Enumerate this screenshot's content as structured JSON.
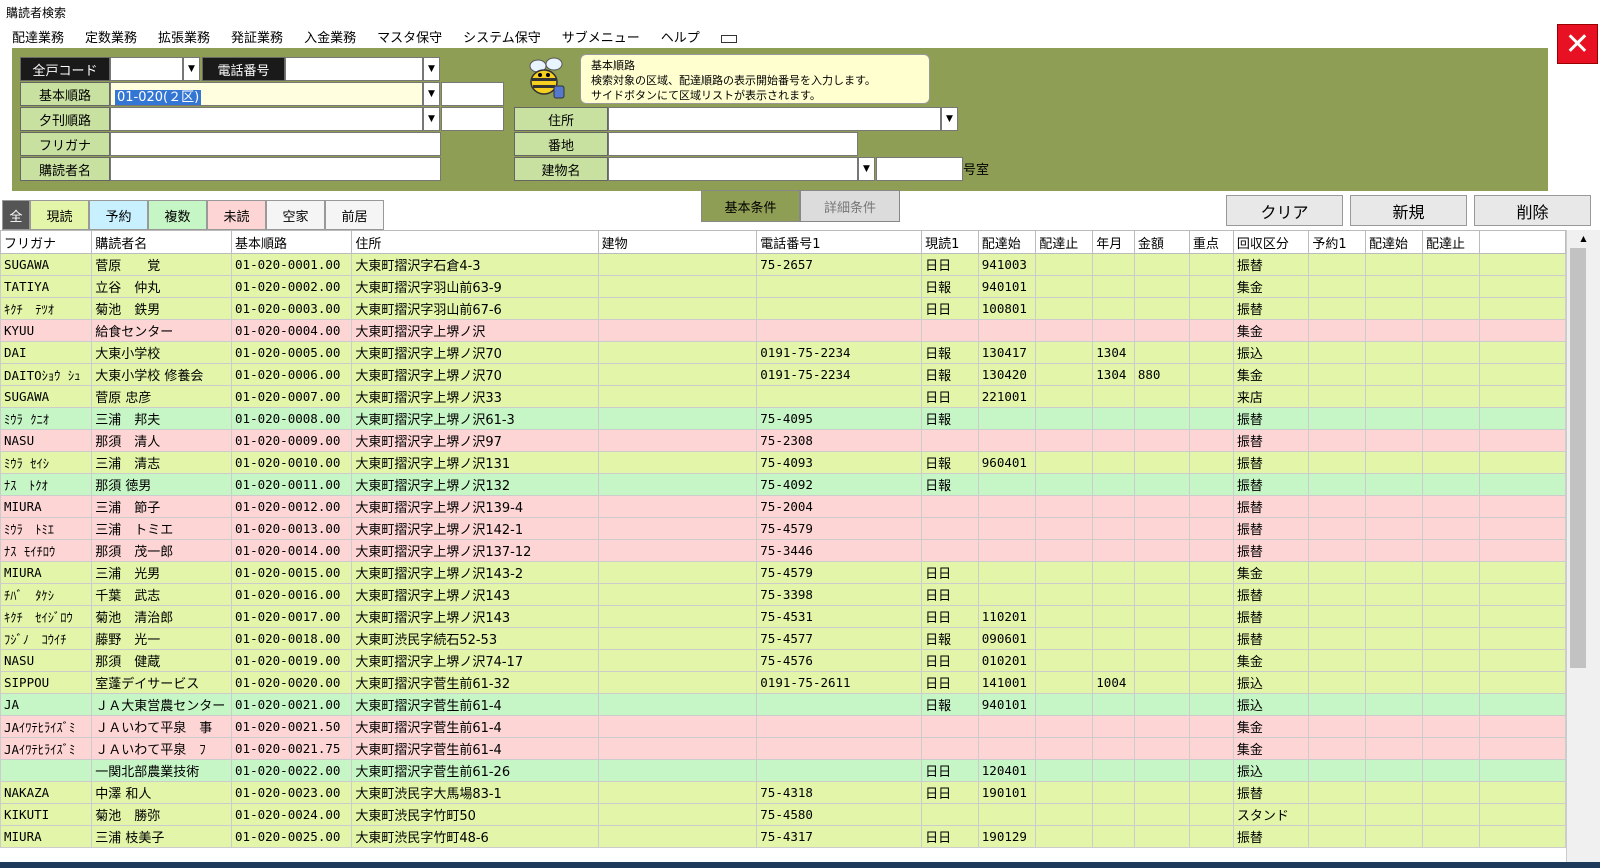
{
  "window": {
    "title": "購読者検索"
  },
  "menu": [
    "配達業務",
    "定数業務",
    "拡張業務",
    "発証業務",
    "入金業務",
    "マスタ保守",
    "システム保守",
    "サブメニュー",
    "ヘルプ"
  ],
  "search": {
    "all_code_label": "全戸コード",
    "all_code_value": "",
    "phone_label": "電話番号",
    "phone_value": "",
    "basic_route_label": "基本順路",
    "basic_route_value": "01-020(２区)",
    "evening_route_label": "夕刊順路",
    "evening_route_value": "",
    "furigana_label": "フリガナ",
    "furigana_value": "",
    "subscriber_name_label": "購読者名",
    "subscriber_name_value": "",
    "address_label": "住所",
    "address_value": "",
    "lot_label": "番地",
    "lot_value": "",
    "building_label": "建物名",
    "building_value": "",
    "room_value": "",
    "room_unit": "号室"
  },
  "tooltip": {
    "title": "基本順路",
    "line1": "検索対象の区域、配達順路の表示開始番号を入力します。",
    "line2": "サイドボタンにて区域リストが表示されます。"
  },
  "filter_tabs": [
    "全",
    "現読",
    "予約",
    "複数",
    "未読",
    "空家",
    "前居"
  ],
  "condition_tabs": {
    "basic": "基本条件",
    "detail": "詳細条件"
  },
  "actions": {
    "clear": "クリア",
    "new": "新規",
    "delete": "削除"
  },
  "colors": {
    "panel": "#8e9e55",
    "row_yellow": "#e2f5a8",
    "row_pink": "#fdd5d5",
    "row_green": "#c6f5c6",
    "close": "#e81123"
  },
  "table": {
    "columns": [
      "フリガナ",
      "購読者名",
      "基本順路",
      "住所",
      "建物",
      "電話番号1",
      "現読1",
      "配達始",
      "配達止",
      "年月",
      "金額",
      "重点",
      "回収区分",
      "予約1",
      "配達始",
      "配達止"
    ],
    "rows": [
      {
        "c": "y",
        "cells": [
          "SUGAWA",
          "菅原　　覚",
          "01-020-0001.00",
          "大東町摺沢字石倉4-3",
          "",
          "75-2657",
          "日日",
          "941003",
          "",
          "",
          "",
          "",
          "振替",
          "",
          "",
          ""
        ]
      },
      {
        "c": "y",
        "cells": [
          "TATIYA",
          "立谷　仲丸",
          "01-020-0002.00",
          "大東町摺沢字羽山前63-9",
          "",
          "",
          "日報",
          "940101",
          "",
          "",
          "",
          "",
          "集金",
          "",
          "",
          ""
        ]
      },
      {
        "c": "y",
        "cells": [
          "ｷｸﾁ　ﾃﾂｵ",
          "菊池　鉄男",
          "01-020-0003.00",
          "大東町摺沢字羽山前67-6",
          "",
          "",
          "日日",
          "100801",
          "",
          "",
          "",
          "",
          "振替",
          "",
          "",
          ""
        ]
      },
      {
        "c": "p",
        "cells": [
          "KYUU",
          "給食センター",
          "01-020-0004.00",
          "大東町摺沢字上堺ノ沢",
          "",
          "",
          "",
          "",
          "",
          "",
          "",
          "",
          "集金",
          "",
          "",
          ""
        ]
      },
      {
        "c": "y",
        "cells": [
          "DAI",
          "大東小学校",
          "01-020-0005.00",
          "大東町摺沢字上堺ノ沢70",
          "",
          "0191-75-2234",
          "日報",
          "130417",
          "",
          "1304",
          "",
          "",
          "振込",
          "",
          "",
          ""
        ]
      },
      {
        "c": "y",
        "cells": [
          "DAITOｼｮｳ ｼｭ",
          "大東小学校 修養会",
          "01-020-0006.00",
          "大東町摺沢字上堺ノ沢70",
          "",
          "0191-75-2234",
          "日報",
          "130420",
          "",
          "1304",
          "880",
          "",
          "集金",
          "",
          "",
          ""
        ]
      },
      {
        "c": "y",
        "cells": [
          "SUGAWA",
          "菅原 忠彦",
          "01-020-0007.00",
          "大東町摺沢字上堺ノ沢33",
          "",
          "",
          "日日",
          "221001",
          "",
          "",
          "",
          "",
          "来店",
          "",
          "",
          ""
        ]
      },
      {
        "c": "g",
        "cells": [
          "ﾐｳﾗ ｸﾆｵ",
          "三浦　邦夫",
          "01-020-0008.00",
          "大東町摺沢字上堺ノ沢61-3",
          "",
          "75-4095",
          "日報",
          "",
          "",
          "",
          "",
          "",
          "振替",
          "",
          "",
          ""
        ]
      },
      {
        "c": "p",
        "cells": [
          "NASU",
          "那須　清人",
          "01-020-0009.00",
          "大東町摺沢字上堺ノ沢97",
          "",
          "75-2308",
          "",
          "",
          "",
          "",
          "",
          "",
          "振替",
          "",
          "",
          ""
        ]
      },
      {
        "c": "y",
        "cells": [
          "ﾐｳﾗ ｾｲｼ",
          "三浦　清志",
          "01-020-0010.00",
          "大東町摺沢字上堺ノ沢131",
          "",
          "75-4093",
          "日報",
          "960401",
          "",
          "",
          "",
          "",
          "振替",
          "",
          "",
          ""
        ]
      },
      {
        "c": "g",
        "cells": [
          "ﾅｽ　ﾄｸｵ",
          "那須 徳男",
          "01-020-0011.00",
          "大東町摺沢字上堺ノ沢132",
          "",
          "75-4092",
          "日報",
          "",
          "",
          "",
          "",
          "",
          "振替",
          "",
          "",
          ""
        ]
      },
      {
        "c": "p",
        "cells": [
          "MIURA",
          "三浦　節子",
          "01-020-0012.00",
          "大東町摺沢字上堺ノ沢139-4",
          "",
          "75-2004",
          "",
          "",
          "",
          "",
          "",
          "",
          "振替",
          "",
          "",
          ""
        ]
      },
      {
        "c": "p",
        "cells": [
          "ﾐｳﾗ　ﾄﾐｴ",
          "三浦　トミエ",
          "01-020-0013.00",
          "大東町摺沢字上堺ノ沢142-1",
          "",
          "75-4579",
          "",
          "",
          "",
          "",
          "",
          "",
          "振替",
          "",
          "",
          ""
        ]
      },
      {
        "c": "p",
        "cells": [
          "ﾅｽ ﾓｲﾁﾛｳ",
          "那須　茂一郎",
          "01-020-0014.00",
          "大東町摺沢字上堺ノ沢137-12",
          "",
          "75-3446",
          "",
          "",
          "",
          "",
          "",
          "",
          "振替",
          "",
          "",
          ""
        ]
      },
      {
        "c": "y",
        "cells": [
          "MIURA",
          "三浦　光男",
          "01-020-0015.00",
          "大東町摺沢字上堺ノ沢143-2",
          "",
          "75-4579",
          "日日",
          "",
          "",
          "",
          "",
          "",
          "集金",
          "",
          "",
          ""
        ]
      },
      {
        "c": "y",
        "cells": [
          "ﾁﾊﾞ　ﾀｹｼ",
          "千葉　武志",
          "01-020-0016.00",
          "大東町摺沢字上堺ノ沢143",
          "",
          "75-3398",
          "日日",
          "",
          "",
          "",
          "",
          "",
          "振替",
          "",
          "",
          ""
        ]
      },
      {
        "c": "y",
        "cells": [
          "ｷｸﾁ　ｾｲｼﾞﾛｳ",
          "菊池　清治郎",
          "01-020-0017.00",
          "大東町摺沢字上堺ノ沢143",
          "",
          "75-4531",
          "日日",
          "110201",
          "",
          "",
          "",
          "",
          "振替",
          "",
          "",
          ""
        ]
      },
      {
        "c": "y",
        "cells": [
          "ﾌｼﾞﾉ　ｺｳｲﾁ",
          "藤野　光一",
          "01-020-0018.00",
          "大東町渋民字続石52-53",
          "",
          "75-4577",
          "日報",
          "090601",
          "",
          "",
          "",
          "",
          "振替",
          "",
          "",
          ""
        ]
      },
      {
        "c": "y",
        "cells": [
          "NASU",
          "那須　健蔵",
          "01-020-0019.00",
          "大東町摺沢字上堺ノ沢74-17",
          "",
          "75-4576",
          "日日",
          "010201",
          "",
          "",
          "",
          "",
          "集金",
          "",
          "",
          ""
        ]
      },
      {
        "c": "y",
        "cells": [
          "SIPPOU",
          "室蓬デイサービス",
          "01-020-0020.00",
          "大東町摺沢字菅生前61-32",
          "",
          "0191-75-2611",
          "日日",
          "141001",
          "",
          "1004",
          "",
          "",
          "振込",
          "",
          "",
          ""
        ]
      },
      {
        "c": "g",
        "cells": [
          "JA",
          "ＪＡ大東営農センター",
          "01-020-0021.00",
          "大東町摺沢字菅生前61-4",
          "",
          "",
          "日報",
          "940101",
          "",
          "",
          "",
          "",
          "振込",
          "",
          "",
          ""
        ]
      },
      {
        "c": "p",
        "cells": [
          "JAｲﾜﾃﾋﾗｲｽﾞﾐ",
          "ＪＡいわて平泉　事",
          "01-020-0021.50",
          "大東町摺沢字菅生前61-4",
          "",
          "",
          "",
          "",
          "",
          "",
          "",
          "",
          "集金",
          "",
          "",
          ""
        ]
      },
      {
        "c": "p",
        "cells": [
          "JAｲﾜﾃﾋﾗｲｽﾞﾐ",
          "ＪＡいわて平泉　ﾌ",
          "01-020-0021.75",
          "大東町摺沢字菅生前61-4",
          "",
          "",
          "",
          "",
          "",
          "",
          "",
          "",
          "集金",
          "",
          "",
          ""
        ]
      },
      {
        "c": "g",
        "cells": [
          "",
          "一関北部農業技術",
          "01-020-0022.00",
          "大東町摺沢字菅生前61-26",
          "",
          "",
          "日日",
          "120401",
          "",
          "",
          "",
          "",
          "振込",
          "",
          "",
          ""
        ]
      },
      {
        "c": "y",
        "cells": [
          "NAKAZA",
          "中澤 和人",
          "01-020-0023.00",
          "大東町渋民字大馬場83-1",
          "",
          "75-4318",
          "日日",
          "190101",
          "",
          "",
          "",
          "",
          "振替",
          "",
          "",
          ""
        ]
      },
      {
        "c": "y",
        "cells": [
          "KIKUTI",
          "菊池　勝弥",
          "01-020-0024.00",
          "大東町渋民字竹町50",
          "",
          "75-4580",
          "",
          "",
          "",
          "",
          "",
          "",
          "スタンド",
          "",
          "",
          ""
        ]
      },
      {
        "c": "y",
        "cells": [
          "MIURA",
          "三浦 枝美子",
          "01-020-0025.00",
          "大東町渋民字竹町48-6",
          "",
          "75-4317",
          "日日",
          "190129",
          "",
          "",
          "",
          "",
          "振替",
          "",
          "",
          ""
        ]
      }
    ]
  }
}
